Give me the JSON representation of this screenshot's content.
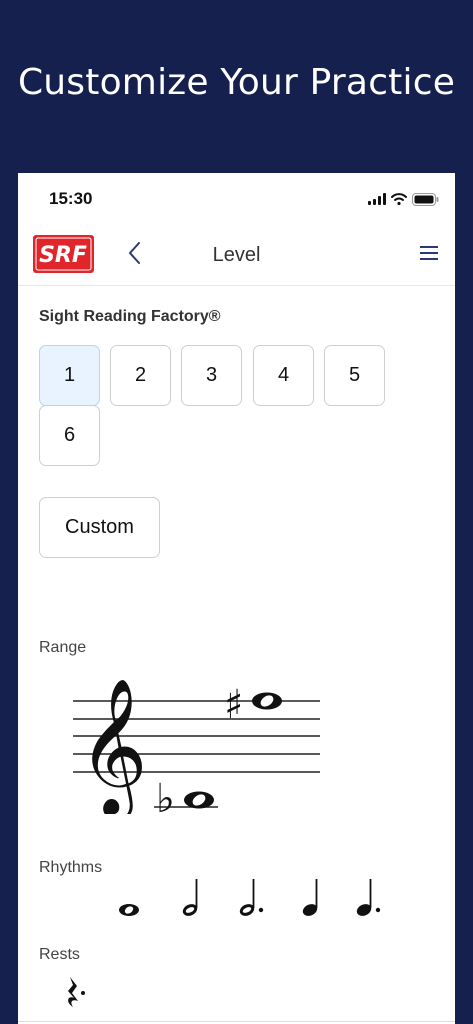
{
  "headline": "Customize Your Practice",
  "status_bar": {
    "time": "15:30"
  },
  "nav": {
    "logo_text": "SRF",
    "title": "Level"
  },
  "brand_label": "Sight Reading Factory®",
  "levels": [
    "1",
    "2",
    "3",
    "4",
    "5",
    "6"
  ],
  "selected_level": "1",
  "custom_label": "Custom",
  "range": {
    "label": "Range",
    "low_note": "B♭3",
    "high_note": "F♯5"
  },
  "rhythms": {
    "label": "Rhythms",
    "items": [
      "whole-note",
      "half-note",
      "dotted-half-note",
      "quarter-note",
      "dotted-quarter-note"
    ]
  },
  "rests": {
    "label": "Rests",
    "items": [
      "dotted-quarter-rest"
    ]
  },
  "colors": {
    "background": "#15204f",
    "logo_red": "#e0262b",
    "selected_fill": "#e9f3ff",
    "accent": "#2b3a75"
  }
}
